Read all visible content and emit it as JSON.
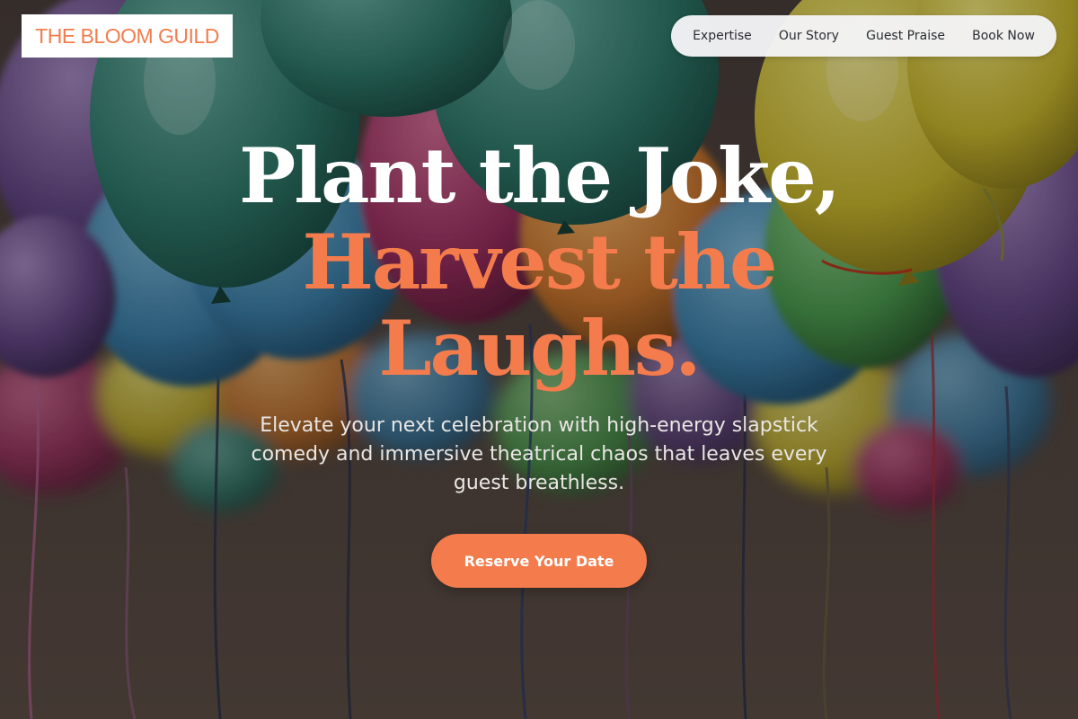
{
  "brand": {
    "logo_text": "THE BLOOM GUILD",
    "accent_color": "#f47c4c"
  },
  "nav": {
    "items": [
      {
        "label": "Expertise"
      },
      {
        "label": "Our Story"
      },
      {
        "label": "Guest Praise"
      },
      {
        "label": "Book Now"
      }
    ]
  },
  "hero": {
    "background_image": "colorful balloons with hanging ribbons",
    "headline_line1": "Plant the Joke,",
    "headline_line2": "Harvest the Laughs.",
    "subtitle": "Elevate your next celebration with high-energy slapstick comedy and immersive theatrical chaos that leaves every guest breathless.",
    "cta_label": "Reserve Your Date"
  }
}
